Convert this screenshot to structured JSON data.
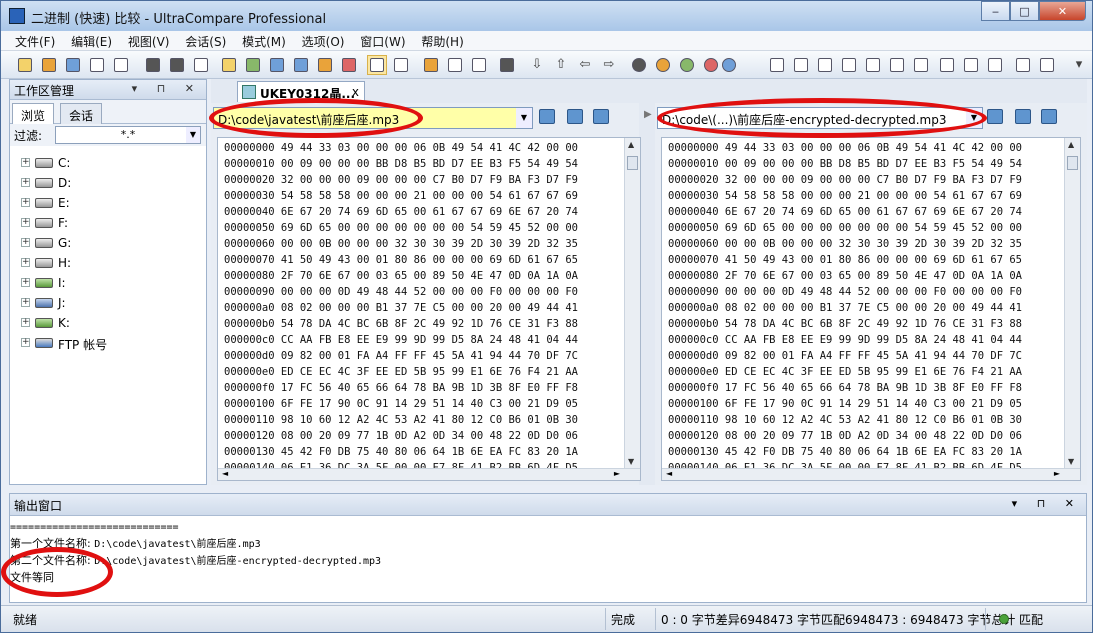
{
  "window": {
    "title": "二进制 (快速) 比较 - UltraCompare Professional",
    "min": "‒",
    "max": "□",
    "close": "✕"
  },
  "menu": [
    "文件(F)",
    "编辑(E)",
    "视图(V)",
    "会话(S)",
    "模式(M)",
    "选项(O)",
    "窗口(W)",
    "帮助(H)"
  ],
  "workspace": {
    "title": "工作区管理",
    "pins": "▾ ⊓ ✕",
    "tabs": [
      "浏览",
      "会话"
    ],
    "filter_label": "过滤:",
    "filter_value": "*.*",
    "drives": [
      "C:",
      "D:",
      "E:",
      "F:",
      "G:",
      "H:",
      "I:",
      "J:",
      "K:",
      "FTP 帐号"
    ]
  },
  "document_tab": {
    "label": "UKEY0312晶...",
    "close": "x"
  },
  "left_pane": {
    "path": "D:\\code\\javatest\\前座后座.mp3",
    "rows": [
      "00000000 49 44 33 03 00 00 00 06 0B 49 54 41 4C 42 00 00",
      "00000010 00 09 00 00 00 BB D8 B5 BD D7 EE B3 F5 54 49 54",
      "00000020 32 00 00 00 09 00 00 00 C7 B0 D7 F9 BA F3 D7 F9",
      "00000030 54 58 58 58 00 00 00 21 00 00 00 54 61 67 67 69",
      "00000040 6E 67 20 74 69 6D 65 00 61 67 67 69 6E 67 20 74",
      "00000050 69 6D 65 00 00 00 00 00 00 00 54 59 45 52 00 00",
      "00000060 00 00 0B 00 00 00 32 30 30 39 2D 30 39 2D 32 35",
      "00000070 41 50 49 43 00 01 80 86 00 00 00 69 6D 61 67 65",
      "00000080 2F 70 6E 67 00 03 65 00 89 50 4E 47 0D 0A 1A 0A",
      "00000090 00 00 00 0D 49 48 44 52 00 00 00 F0 00 00 00 F0",
      "000000a0 08 02 00 00 00 B1 37 7E C5 00 00 20 00 49 44 41",
      "000000b0 54 78 DA 4C BC 6B 8F 2C 49 92 1D 76 CE 31 F3 88",
      "000000c0 CC AA FB E8 EE E9 99 9D 99 D5 8A 24 48 41 04 44",
      "000000d0 09 82 00 01 FA A4 FF FF 45 5A 41 94 44 70 DF 7C",
      "000000e0 ED CE EC 4C 3F EE ED 5B 95 99 E1 6E 76 F4 21 AA",
      "000000f0 17 FC 56 40 65 66 64 78 BA 9B 1D 3B 8F E0 FF F8",
      "00000100 6F FE 17 90 0C 91 14 29 51 14 40 C3 00 21 D9 05",
      "00000110 98 10 60 12 A2 4C 53 A2 41 80 12 C0 B6 01 0B 30",
      "00000120 08 00 20 09 77 1B 0D A2 0D 34 00 48 22 0D D0 06",
      "00000130 45 42 F0 DB 75 40 80 06 64 1B 6E EA FC 83 20 1A",
      "00000140 06 E1 36 DC 3A 5F 00 00 E7 8F 41 B2 BB 6D 4F D5"
    ]
  },
  "right_pane": {
    "path": "D:\\code\\(...)\\前座后座-encrypted-decrypted.mp3",
    "rows": [
      "00000000 49 44 33 03 00 00 00 06 0B 49 54 41 4C 42 00 00",
      "00000010 00 09 00 00 00 BB D8 B5 BD D7 EE B3 F5 54 49 54",
      "00000020 32 00 00 00 09 00 00 00 C7 B0 D7 F9 BA F3 D7 F9",
      "00000030 54 58 58 58 00 00 00 21 00 00 00 54 61 67 67 69",
      "00000040 6E 67 20 74 69 6D 65 00 61 67 67 69 6E 67 20 74",
      "00000050 69 6D 65 00 00 00 00 00 00 00 54 59 45 52 00 00",
      "00000060 00 00 0B 00 00 00 32 30 30 39 2D 30 39 2D 32 35",
      "00000070 41 50 49 43 00 01 80 86 00 00 00 69 6D 61 67 65",
      "00000080 2F 70 6E 67 00 03 65 00 89 50 4E 47 0D 0A 1A 0A",
      "00000090 00 00 00 0D 49 48 44 52 00 00 00 F0 00 00 00 F0",
      "000000a0 08 02 00 00 00 B1 37 7E C5 00 00 20 00 49 44 41",
      "000000b0 54 78 DA 4C BC 6B 8F 2C 49 92 1D 76 CE 31 F3 88",
      "000000c0 CC AA FB E8 EE E9 99 9D 99 D5 8A 24 48 41 04 44",
      "000000d0 09 82 00 01 FA A4 FF FF 45 5A 41 94 44 70 DF 7C",
      "000000e0 ED CE EC 4C 3F EE ED 5B 95 99 E1 6E 76 F4 21 AA",
      "000000f0 17 FC 56 40 65 66 64 78 BA 9B 1D 3B 8F E0 FF F8",
      "00000100 6F FE 17 90 0C 91 14 29 51 14 40 C3 00 21 D9 05",
      "00000110 98 10 60 12 A2 4C 53 A2 41 80 12 C0 B6 01 0B 30",
      "00000120 08 00 20 09 77 1B 0D A2 0D 34 00 48 22 0D D0 06",
      "00000130 45 42 F0 DB 75 40 80 06 64 1B 6E EA FC 83 20 1A",
      "00000140 06 E1 36 DC 3A 5F 00 00 E7 8F 41 B2 BB 6D 4F D5"
    ]
  },
  "output": {
    "title": "输出窗口",
    "pins": "▾ ⊓ ✕",
    "separator": "============================",
    "line1_label": "第一个文件名称: ",
    "line1_path": "D:\\code\\javatest\\前座后座.mp3",
    "line2_label": "第二个文件名称: ",
    "line2_path": "D:\\code\\javatest\\前座后座-encrypted-decrypted.mp3",
    "result": "文件等同"
  },
  "status": {
    "ready": "就绪",
    "done": "完成",
    "summary": "0 : 0 字节差异6948473 字节匹配6948473 : 6948473 字节总计",
    "match": "匹配"
  },
  "colors": {
    "left_path_bg": "#ffffa8",
    "right_path_bg": "#ffffff",
    "annotation": "#e01010",
    "match_dot": "#4aa23a"
  }
}
